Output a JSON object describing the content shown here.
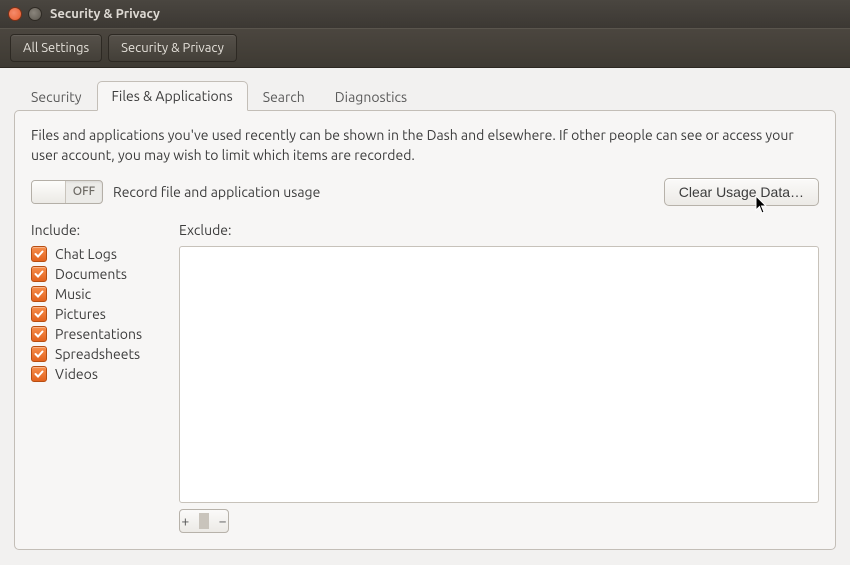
{
  "window": {
    "title": "Security & Privacy"
  },
  "breadcrumb": {
    "all_settings": "All Settings",
    "current": "Security & Privacy"
  },
  "tabs": [
    {
      "id": "security",
      "label": "Security",
      "active": false
    },
    {
      "id": "files",
      "label": "Files & Applications",
      "active": true
    },
    {
      "id": "search",
      "label": "Search",
      "active": false
    },
    {
      "id": "diagnostics",
      "label": "Diagnostics",
      "active": false
    }
  ],
  "files_tab": {
    "description": "Files and applications you've used recently can be shown in the Dash and elsewhere. If other people can see or access your user account, you may wish to limit which items are recorded.",
    "record_toggle": {
      "state": "OFF",
      "label": "Record file and application usage"
    },
    "clear_button": "Clear Usage Data…",
    "include": {
      "header": "Include:",
      "items": [
        {
          "label": "Chat Logs",
          "checked": true
        },
        {
          "label": "Documents",
          "checked": true
        },
        {
          "label": "Music",
          "checked": true
        },
        {
          "label": "Pictures",
          "checked": true
        },
        {
          "label": "Presentations",
          "checked": true
        },
        {
          "label": "Spreadsheets",
          "checked": true
        },
        {
          "label": "Videos",
          "checked": true
        }
      ]
    },
    "exclude": {
      "header": "Exclude:",
      "add_label": "+",
      "remove_label": "−"
    }
  },
  "colors": {
    "accent": "#e3631e"
  }
}
